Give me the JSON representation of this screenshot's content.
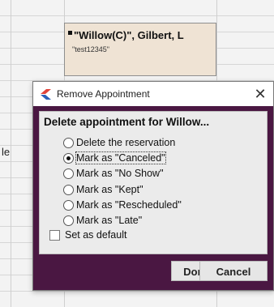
{
  "background": {
    "edge_label": "le",
    "appointment": {
      "title": "\"Willow(C)\", Gilbert, L",
      "subtitle": "\"test12345\""
    }
  },
  "dialog": {
    "icon": "app-logo-icon",
    "title": "Remove Appointment",
    "close_label": "✕",
    "heading": "Delete appointment for Willow...",
    "options": [
      {
        "label": "Delete the reservation",
        "checked": false
      },
      {
        "label": "Mark as \"Canceled\"",
        "checked": true
      },
      {
        "label": "Mark as \"No Show\"",
        "checked": false
      },
      {
        "label": "Mark as \"Kept\"",
        "checked": false
      },
      {
        "label": "Mark as \"Rescheduled\"",
        "checked": false
      },
      {
        "label": "Mark as \"Late\"",
        "checked": false
      }
    ],
    "set_default_label": "Set as default",
    "set_default_checked": false,
    "done_label": "Done",
    "cancel_label": "Cancel"
  },
  "colors": {
    "dialog_body": "#4a1742",
    "panel": "#ebebeb",
    "appointment_bg": "#efe3d4",
    "icon_red": "#e0433a",
    "icon_blue": "#2b5fb8"
  }
}
